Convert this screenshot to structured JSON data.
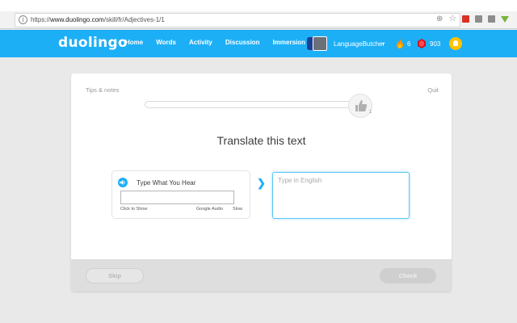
{
  "browser": {
    "url_scheme": "https://",
    "url_host": "www.duolingo.com",
    "url_path": "/skill/fr/Adjectives-1/1",
    "icons": [
      "back-icon",
      "forward-icon",
      "reload-icon",
      "zoom-icon",
      "star-icon",
      "extension-red-icon",
      "cast-icon",
      "extension-gray-icon",
      "extension-green-icon",
      "menu-icon"
    ]
  },
  "header": {
    "logo": "duolingo",
    "nav": [
      "Home",
      "Words",
      "Activity",
      "Discussion",
      "Immersion"
    ],
    "username": "LanguageButcher",
    "caret": "⌄",
    "streak": "6",
    "lingots": "903",
    "colors": {
      "brand": "#1caff6",
      "bell": "#ffc200",
      "flame": "#ff9600",
      "gem": "#d7131e"
    }
  },
  "lesson": {
    "tips": "Tips & notes",
    "quit": "Quit",
    "progress": 0,
    "thumbs_count": "1",
    "title": "Translate this text",
    "prompt_label": "Type What You Hear",
    "click_to_show": "Click to Show",
    "google_audio": "Google Audio",
    "slow": "Slow",
    "answer_placeholder": "Type in English",
    "arrow": "❯",
    "skip": "Skip",
    "check": "Check"
  }
}
